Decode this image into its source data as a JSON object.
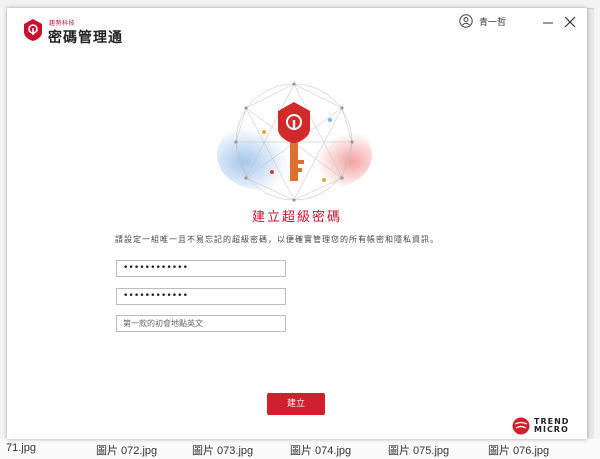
{
  "app": {
    "brand_small": "趨勢科技",
    "title": "密碼管理通",
    "user_label": "青一哲"
  },
  "window_controls": {
    "minimize": "—",
    "close": "✕"
  },
  "main": {
    "heading": "建立超級密碼",
    "description": "請設定一組唯一且不易忘記的超級密碼，以便確實管理您的所有帳密和隱私資訊。",
    "password_value": "••••••••••••",
    "confirm_value": "••••••••••••",
    "hint_placeholder": "第一款的初會地點英文",
    "create_button": "建立"
  },
  "vendor": {
    "line1": "TREND",
    "line2": "MICRO"
  },
  "background": {
    "captions": [
      "71.jpg",
      "圖片 072.jpg",
      "圖片 073.jpg",
      "圖片 074.jpg",
      "圖片 075.jpg",
      "圖片 076.jpg"
    ]
  },
  "colors": {
    "accent": "#d01f2e",
    "text": "#333333"
  },
  "icons": [
    "shield-logo-icon",
    "user-icon",
    "minimize-icon",
    "close-icon",
    "key-hero-icon",
    "trend-micro-logo-icon"
  ]
}
